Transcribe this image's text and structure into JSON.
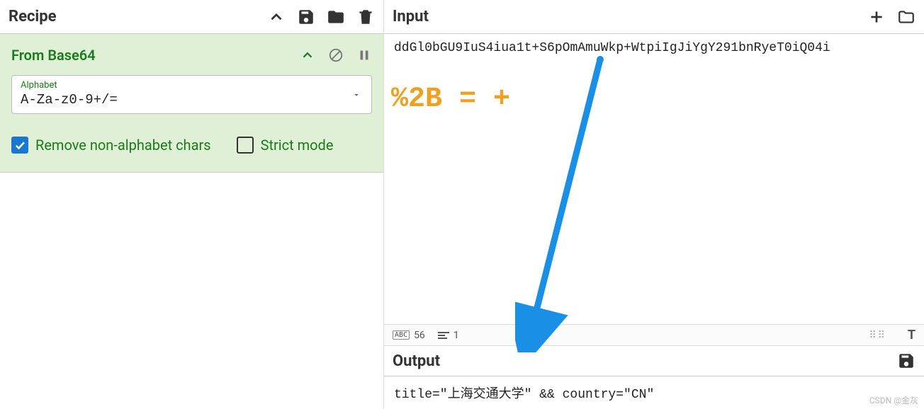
{
  "recipe": {
    "title": "Recipe",
    "operation": {
      "name": "From Base64",
      "alphabet_label": "Alphabet",
      "alphabet_value": "A-Za-z0-9+/=",
      "remove_label": "Remove non-alphabet chars",
      "remove_checked": true,
      "strict_label": "Strict mode",
      "strict_checked": false
    }
  },
  "input": {
    "title": "Input",
    "content": "ddGl0bGU9IuS4iua1t+S6pOmAmuWkp+WtpiIgJiYgY291bnRyeT0iQ04i"
  },
  "stats": {
    "badge": "ABC",
    "chars": "56",
    "lines": "1",
    "right_letter": "T"
  },
  "output": {
    "title": "Output",
    "content": "title=\"上海交通大学\" && country=\"CN\""
  },
  "annotation": {
    "text": "%2B = +"
  },
  "watermark": "CSDN @金灰"
}
